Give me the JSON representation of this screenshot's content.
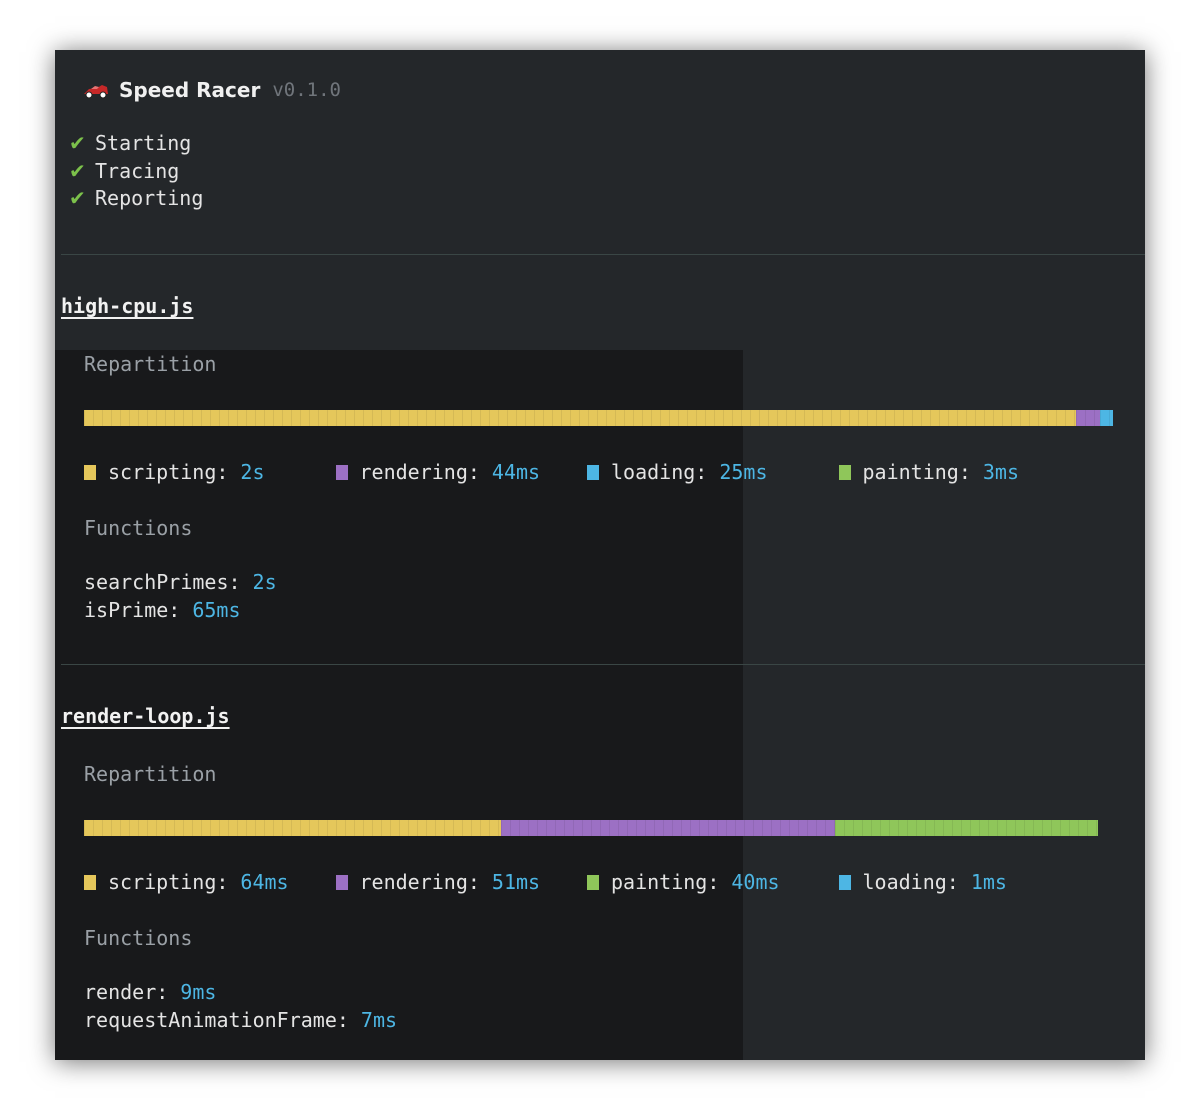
{
  "app": {
    "name": "Speed Racer",
    "version": "v0.1.0"
  },
  "steps": [
    "Starting",
    "Tracing",
    "Reporting"
  ],
  "colors": {
    "scripting": "#e5c75b",
    "rendering": "#9c70c4",
    "loading": "#4db6e4",
    "painting": "#8fc65a",
    "value": "#4db6e4"
  },
  "sections": [
    {
      "file": "high-cpu.js",
      "repartition_label": "Repartition",
      "functions_label": "Functions",
      "bar": [
        {
          "category": "scripting",
          "fraction": 0.964
        },
        {
          "category": "rendering",
          "fraction": 0.023
        },
        {
          "category": "loading",
          "fraction": 0.013
        }
      ],
      "legend": [
        {
          "category": "scripting",
          "label": "scripting:",
          "value": "2s"
        },
        {
          "category": "rendering",
          "label": "rendering:",
          "value": "44ms"
        },
        {
          "category": "loading",
          "label": "loading:",
          "value": "25ms"
        },
        {
          "category": "painting",
          "label": "painting:",
          "value": "3ms"
        }
      ],
      "functions": [
        {
          "name": "searchPrimes:",
          "value": "2s"
        },
        {
          "name": "isPrime:",
          "value": "65ms"
        }
      ]
    },
    {
      "file": "render-loop.js",
      "repartition_label": "Repartition",
      "functions_label": "Functions",
      "bar": [
        {
          "category": "scripting",
          "fraction": 0.41
        },
        {
          "category": "rendering",
          "fraction": 0.328
        },
        {
          "category": "painting",
          "fraction": 0.258
        }
      ],
      "legend": [
        {
          "category": "scripting",
          "label": "scripting:",
          "value": "64ms"
        },
        {
          "category": "rendering",
          "label": "rendering:",
          "value": "51ms"
        },
        {
          "category": "painting",
          "label": "painting:",
          "value": "40ms"
        },
        {
          "category": "loading",
          "label": "loading:",
          "value": "1ms"
        }
      ],
      "functions": [
        {
          "name": "render:",
          "value": "9ms"
        },
        {
          "name": "requestAnimationFrame:",
          "value": "7ms"
        }
      ]
    }
  ]
}
